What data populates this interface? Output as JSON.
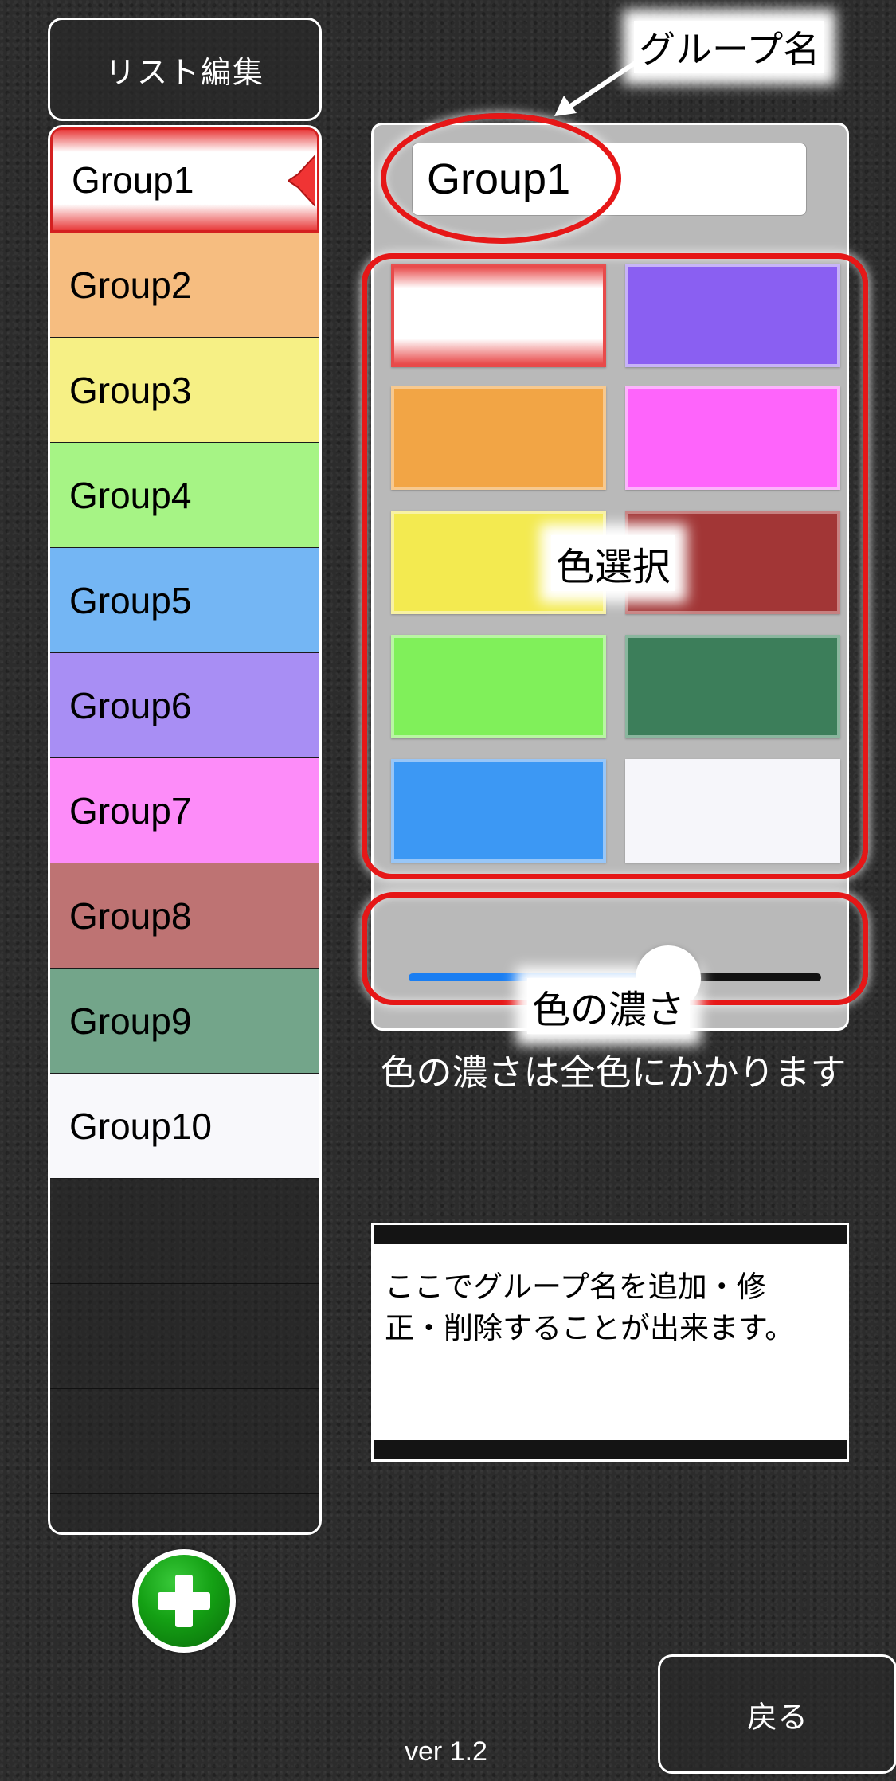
{
  "header": {
    "list_edit_label": "リスト編集"
  },
  "groups": [
    {
      "name": "Group1",
      "color": "#ffffff",
      "selected": true
    },
    {
      "name": "Group2",
      "color": "#f6bd80"
    },
    {
      "name": "Group3",
      "color": "#f6f085"
    },
    {
      "name": "Group4",
      "color": "#a6f485"
    },
    {
      "name": "Group5",
      "color": "#74b6f4"
    },
    {
      "name": "Group6",
      "color": "#a88ef4"
    },
    {
      "name": "Group7",
      "color": "#fd8cf9"
    },
    {
      "name": "Group8",
      "color": "#be7373"
    },
    {
      "name": "Group9",
      "color": "#73a58a"
    },
    {
      "name": "Group10",
      "color": "#f8f8fb"
    }
  ],
  "editor": {
    "group_name_value": "Group1",
    "swatches": [
      {
        "fill": "#ffffff",
        "border": "#e84a4a",
        "selected": true
      },
      {
        "fill": "#8a5ff2",
        "border": "#c7b3f7"
      },
      {
        "fill": "#f2a545",
        "border": "#f7c98f"
      },
      {
        "fill": "#fe64fb",
        "border": "#fdb3fc"
      },
      {
        "fill": "#f3ea50",
        "border": "#f8f2a3"
      },
      {
        "fill": "#a23636",
        "border": "#c78181"
      },
      {
        "fill": "#80f05a",
        "border": "#b9f6a3"
      },
      {
        "fill": "#3c7e5a",
        "border": "#8ab69e"
      },
      {
        "fill": "#3c98f4",
        "border": "#98c6f7"
      },
      {
        "fill": "#f6f6fa",
        "border": "#f6f6fa"
      }
    ],
    "intensity": 0.63
  },
  "annotations": {
    "group_name": "グループ名",
    "color_select": "色選択",
    "color_intensity": "色の濃さ"
  },
  "hint_text": "色の濃さは全色にかかります",
  "info_box": {
    "line1": "ここでグループ名を追加・修",
    "line2": "正・削除することが出来ます。"
  },
  "footer": {
    "version": "ver 1.2",
    "back_label": "戻る"
  },
  "icons": {
    "add": "plus-icon",
    "selection": "selection-arrow-icon",
    "pointer": "arrow-icon"
  }
}
